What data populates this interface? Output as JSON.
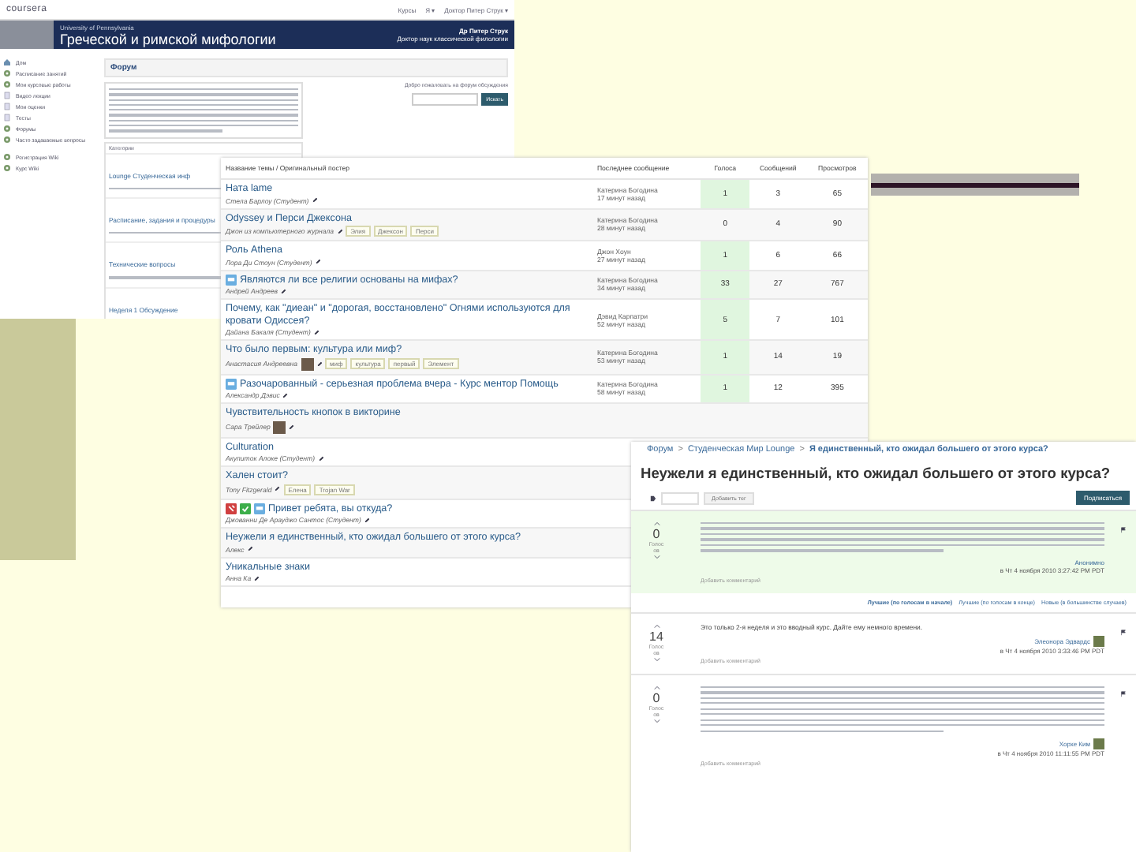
{
  "site_window": {
    "logo": "coursera",
    "top_links": [
      "Курсы",
      "Я ▾",
      "Доктор Питер Струк ▾"
    ],
    "banner": {
      "university": "University of Pennsylvania",
      "course": "Греческой и римской мифологии",
      "instructor": "Др Питер Струк",
      "instructor_note": "Доктор наук классической филологии"
    },
    "sidebar": [
      {
        "label": "Дом"
      },
      {
        "label": "Расписание занятий"
      },
      {
        "label": "Мои курсовые работы"
      },
      {
        "label": "Видео лекции"
      },
      {
        "label": "Мои оценки"
      },
      {
        "label": "Тесты"
      },
      {
        "label": "Форумы"
      },
      {
        "label": "Часто задаваемые вопросы"
      },
      {
        "label": "Регистрация Wiki"
      },
      {
        "label": "Курс Wiki"
      }
    ],
    "forum_heading": "Форум",
    "search": {
      "hint": "Добро пожаловать на форум обсуждения",
      "button": "Искать"
    },
    "category_heading": "Категории",
    "subforums": [
      {
        "title": "Lounge Студенческая инф"
      },
      {
        "title": "Расписание, задания и процедуры"
      },
      {
        "title": "Технические вопросы"
      },
      {
        "title": "Неделя 1 Обсуждение"
      }
    ]
  },
  "topic_window": {
    "columns": [
      "Название темы / Оригинальный постер",
      "Последнее сообщение",
      "Голоса",
      "Сообщений",
      "Просмотров"
    ],
    "topics": [
      {
        "title": "Ната lame",
        "author": "Стела Барлоу (Студент)",
        "avatar": false,
        "last_author": "Катерина Богодина",
        "last_time": "17 минут назад",
        "votes": "1",
        "posts": "3",
        "views": "65",
        "votes_highlighted": true
      },
      {
        "title": "Odyssey и Перси Джексона",
        "author": "Джон из компьютерного журнала",
        "avatar": false,
        "tags": [
          "Элия",
          "Джексон",
          "Перси"
        ],
        "last_author": "Катерина Богодина",
        "last_time": "28 минут назад",
        "votes": "0",
        "posts": "4",
        "views": "90",
        "votes_highlighted": false
      },
      {
        "title": "Роль Athena",
        "author": "Лора Ди Стоун (Студент)",
        "avatar": false,
        "last_author": "Джон Хоун",
        "last_time": "27 минут назад",
        "votes": "1",
        "posts": "6",
        "views": "66",
        "votes_highlighted": true
      },
      {
        "badges": [
          {
            "kind": "chat"
          }
        ],
        "title": "Являются ли все религии основаны на мифах?",
        "author": "Андрей Андреев",
        "avatar": false,
        "last_author": "Катерина Богодина",
        "last_time": "34 минут назад",
        "votes": "33",
        "posts": "27",
        "views": "767",
        "votes_highlighted": true
      },
      {
        "title": "Почему, как \"диеан\" и \"дорогая, восстановлено\" Огнями используются для кровати Одиссея?",
        "author": "Дайана Бакаля (Студент)",
        "avatar": false,
        "last_author": "Дэвид Карпатри",
        "last_time": "52 минут назад",
        "votes": "5",
        "posts": "7",
        "views": "101",
        "votes_highlighted": true
      },
      {
        "title": "Что было первым: культура или миф?",
        "author": "Анастасия Андреевна",
        "avatar": true,
        "tags": [
          "миф",
          "культура",
          "первый",
          "Элемент"
        ],
        "last_author": "Катерина Богодина",
        "last_time": "53 минут назад",
        "votes": "1",
        "posts": "14",
        "views": "19",
        "votes_highlighted": true
      },
      {
        "badges": [
          {
            "kind": "chat"
          }
        ],
        "title": "Разочарованный - серьезная проблема вчера - Курс ментор Помощь",
        "author": "Александр Дэвис",
        "avatar": false,
        "last_author": "Катерина Богодина",
        "last_time": "58 минут назад",
        "votes": "1",
        "posts": "12",
        "views": "395",
        "votes_highlighted": true
      },
      {
        "title": "Чувствительность кнопок в викторине",
        "author": "Сара Трейлер",
        "avatar": true
      },
      {
        "title": "Culturation",
        "author": "Акупиток Алоке (Студент)",
        "avatar": false
      },
      {
        "title": "Хален стоит?",
        "author": "Tony Fitzgerald",
        "avatar": false,
        "tags": [
          "Елена",
          "Trojan War"
        ]
      },
      {
        "badges": [
          {
            "kind": "pin"
          },
          {
            "kind": "check"
          },
          {
            "kind": "chat"
          }
        ],
        "title": "Привет ребята, вы откуда?",
        "author": "Джованни Де Арауджо Сантос (Студент)",
        "avatar": false
      },
      {
        "title": "Неужели я единственный, кто ожидал большего от этого курса?",
        "author": "Алекс",
        "avatar": false
      },
      {
        "title": "Уникальные знаки",
        "author": "Анна Ка",
        "avatar": false
      }
    ]
  },
  "thread_window": {
    "breadcrumb": [
      "Форум",
      "Студенческая Мир Lounge",
      "Я единственный, кто ожидал большего от этого курса?"
    ],
    "breadcrumb_separator": ">",
    "title": "Неужели я единственный, кто ожидал большего от этого курса?",
    "tag_button": "Добавить тег",
    "subscribe_button": "Подписаться",
    "posts": [
      {
        "votes": "0",
        "votes_label": "Голос ов",
        "highlighted": true,
        "author": "Анонимно",
        "avatar": false,
        "date": "в Чт 4 ноября 2010 3:27:42 PM PDT",
        "comment_link": "Добавить комментарий"
      },
      {
        "votes": "14",
        "votes_label": "Голос ов",
        "highlighted": false,
        "body": "Это только 2-я неделя и это вводный курс. Дайте ему немного времени.",
        "author": "Элеонора Эдвардс",
        "avatar": true,
        "date": "в Чт 4 ноября 2010 3:33:46 PM PDT",
        "comment_link": "Добавить комментарий"
      },
      {
        "votes": "0",
        "votes_label": "Голос ов",
        "highlighted": false,
        "author": "Хорхе Ким",
        "avatar": true,
        "date": "в Чт 4 ноября 2010 11:11:55 PM PDT",
        "comment_link": "Добавить комментарий"
      }
    ],
    "sort_links": [
      {
        "label": "Лучшие (по голосам в начале)",
        "selected": true
      },
      {
        "label": "Лучшие (по голосам в конце)",
        "selected": false
      },
      {
        "label": "Новые (в большинстве случаев)",
        "selected": false
      }
    ]
  }
}
